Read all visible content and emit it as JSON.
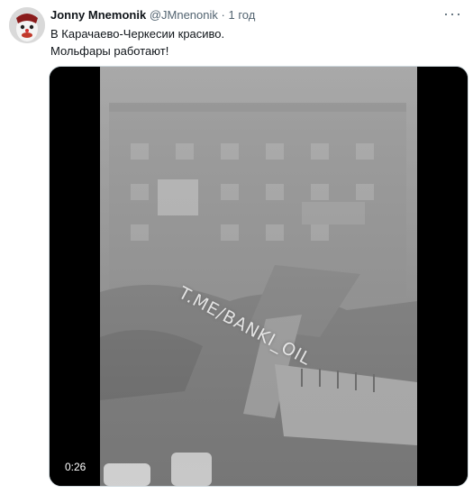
{
  "tweet": {
    "author_name": "Jonny Mnemonik",
    "handle": "@JMnenonik",
    "separator": "·",
    "time": "1 год",
    "more_label": "···",
    "text_line1": "В Карачаево-Черкесии красиво.",
    "text_line2": "Мольфары работают!"
  },
  "media": {
    "duration": "0:26",
    "watermark": "T.ME/BANKI_OIL"
  },
  "colors": {
    "secondary_text": "#536471",
    "media_border": "#cfd9de"
  }
}
